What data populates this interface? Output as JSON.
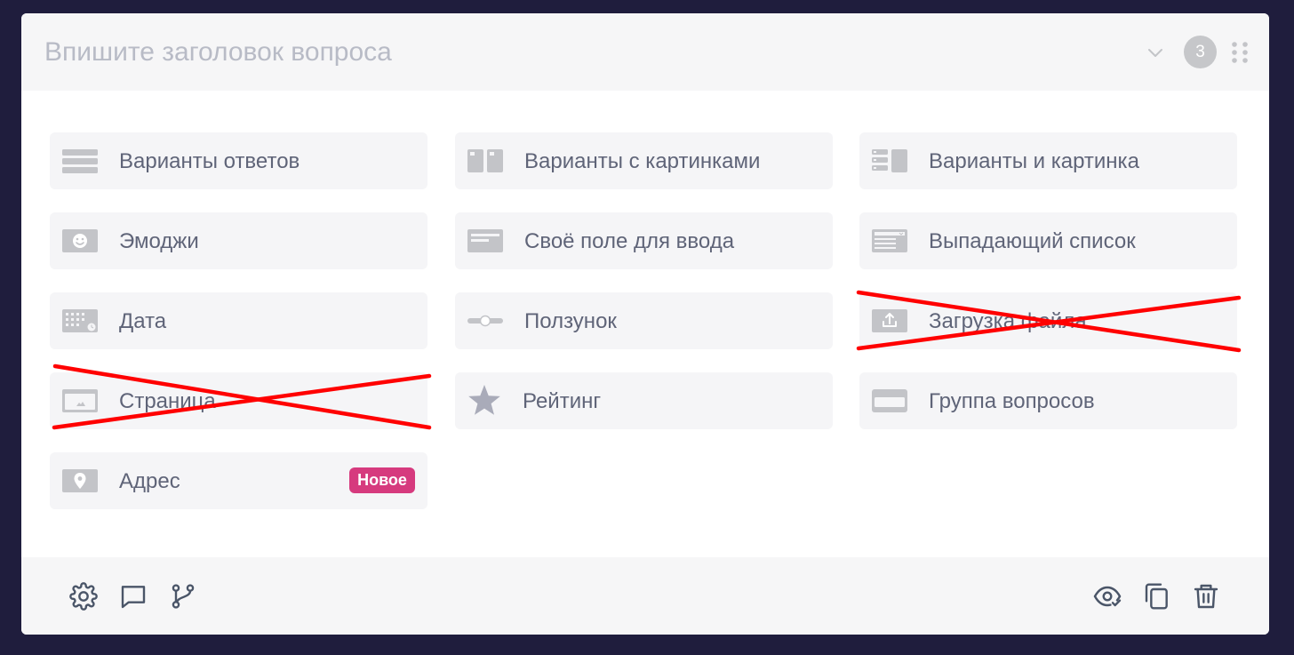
{
  "header": {
    "title_placeholder": "Впишите заголовок вопроса",
    "title_value": "",
    "question_number": "3",
    "icons": [
      "chevron-down-icon",
      "drag-handle-icon"
    ]
  },
  "question_types": [
    {
      "label": "Варианты ответов",
      "icon": "list-icon",
      "crossed_out": false
    },
    {
      "label": "Варианты с картинками",
      "icon": "image-columns-icon",
      "crossed_out": false
    },
    {
      "label": "Варианты и картинка",
      "icon": "list-with-image-icon",
      "crossed_out": false
    },
    {
      "label": "Эмоджи",
      "icon": "emoji-icon",
      "crossed_out": false
    },
    {
      "label": "Своё поле для ввода",
      "icon": "text-field-icon",
      "crossed_out": false
    },
    {
      "label": "Выпадающий список",
      "icon": "dropdown-icon",
      "crossed_out": false
    },
    {
      "label": "Дата",
      "icon": "calendar-icon",
      "crossed_out": false
    },
    {
      "label": "Ползунок",
      "icon": "slider-icon",
      "crossed_out": false
    },
    {
      "label": "Загрузка файла",
      "icon": "upload-icon",
      "crossed_out": true
    },
    {
      "label": "Страница",
      "icon": "page-icon",
      "crossed_out": true
    },
    {
      "label": "Рейтинг",
      "icon": "star-icon",
      "crossed_out": false
    },
    {
      "label": "Группа вопросов",
      "icon": "group-icon",
      "crossed_out": false
    },
    {
      "label": "Адрес",
      "icon": "location-pin-icon",
      "crossed_out": false,
      "badge": "Новое"
    }
  ],
  "footer": {
    "left_icons": [
      "settings-icon",
      "comment-icon",
      "branch-logic-icon"
    ],
    "right_icons": [
      "preview-icon",
      "duplicate-icon",
      "delete-icon"
    ]
  },
  "colors": {
    "background": "#1f1d3d",
    "card": "#ffffff",
    "tile": "#f5f5f7",
    "icon": "#c3c4c8",
    "text": "#5f6478",
    "badge_new": "#d63a7e",
    "cross_out": "#ff0000",
    "footer_icon": "#4a5568"
  }
}
